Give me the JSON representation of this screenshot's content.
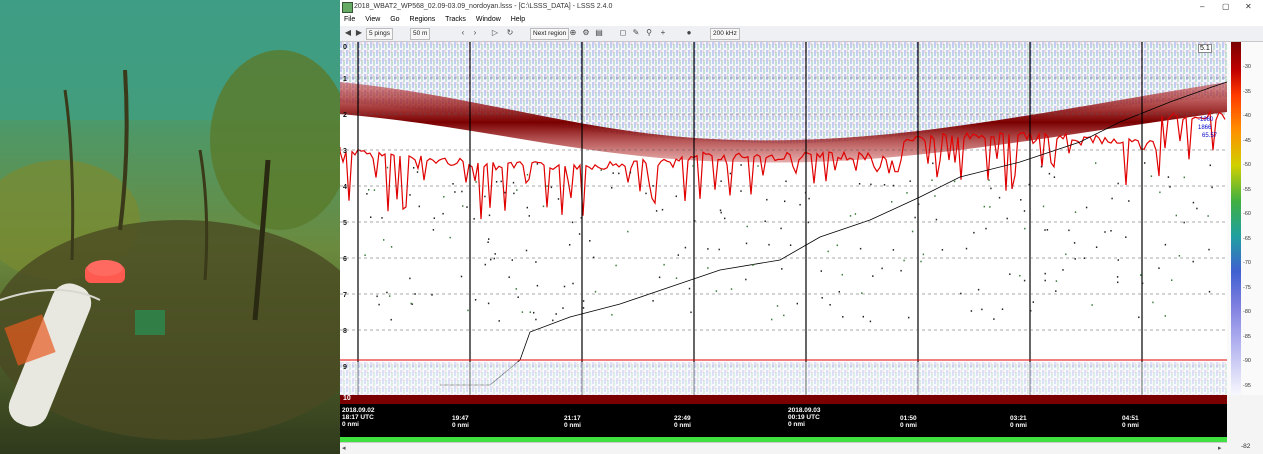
{
  "window": {
    "title": "2018_WBAT2_WP568_02.09-03.09_nordoyan.lsss - [C:\\LSSS_DATA] - LSSS 2.4.0",
    "minimize": "–",
    "maximize": "▢",
    "close": "✕"
  },
  "menu": [
    "File",
    "View",
    "Go",
    "Regions",
    "Tracks",
    "Window",
    "Help"
  ],
  "toolbar": {
    "pings": "5 pings",
    "range": "50 m",
    "next_region": "Next region",
    "frequency": "200 kHz"
  },
  "echogram": {
    "depth_labels": [
      "1",
      "2",
      "3",
      "4",
      "5",
      "6",
      "7",
      "8",
      "9",
      "10"
    ],
    "top_right_value": "5.1",
    "side_readouts": [
      "-1960",
      "1866",
      "65.57"
    ]
  },
  "color_scale": {
    "labels": [
      "-30",
      "-35",
      "-40",
      "-45",
      "-50",
      "-55",
      "-60",
      "-65",
      "-70",
      "-75",
      "-80",
      "-85",
      "-90",
      "-95"
    ],
    "threshold": "-82"
  },
  "timeline": {
    "dates": [
      {
        "date": "2018.09.02",
        "time": "18:17 UTC",
        "dist": "0 nmi"
      },
      {
        "date": "",
        "time": "19:47",
        "dist": "0 nmi"
      },
      {
        "date": "",
        "time": "21:17",
        "dist": "0 nmi"
      },
      {
        "date": "",
        "time": "22:49",
        "dist": "0 nmi"
      },
      {
        "date": "2018.09.03",
        "time": "00:19 UTC",
        "dist": "0 nmi"
      },
      {
        "date": "",
        "time": "01:50",
        "dist": "0 nmi"
      },
      {
        "date": "",
        "time": "03:21",
        "dist": "0 nmi"
      },
      {
        "date": "",
        "time": "04:51",
        "dist": "0 nmi"
      }
    ]
  },
  "colors": {
    "seabed": "#8b0000",
    "bottom_line": "#e00000",
    "track": "#000000",
    "timeline_bg": "#000000",
    "nav_bar": "#3fe040"
  }
}
